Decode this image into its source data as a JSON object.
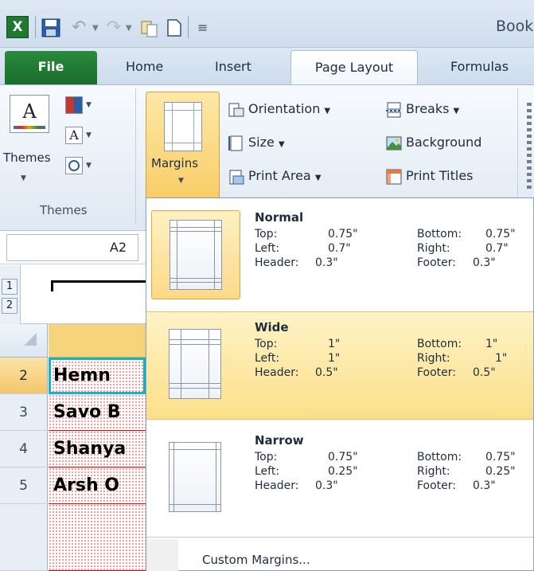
{
  "qat": {
    "app_icon": "excel-logo-icon",
    "logo_letter": "X",
    "title": "Book"
  },
  "tabs": [
    {
      "label": "File"
    },
    {
      "label": "Home"
    },
    {
      "label": "Insert"
    },
    {
      "label": "Page Layout",
      "active": true
    },
    {
      "label": "Formulas"
    }
  ],
  "ribbon": {
    "themes": {
      "label": "Themes",
      "group_title": "Themes",
      "font_glyph": "A"
    },
    "margins": {
      "label": "Margins"
    },
    "orientation": {
      "label": "Orientation"
    },
    "size": {
      "label": "Size"
    },
    "print_area": {
      "label": "Print Area"
    },
    "breaks": {
      "label": "Breaks"
    },
    "background": {
      "label": "Background"
    },
    "print_titles": {
      "label": "Print Titles"
    }
  },
  "namebox": {
    "value": "A2"
  },
  "outline": {
    "levels": [
      "1",
      "2"
    ]
  },
  "rows": [
    {
      "num": "2",
      "text": "Hemn ",
      "selected": true
    },
    {
      "num": "3",
      "text": "Savo B"
    },
    {
      "num": "4",
      "text": "Shanya"
    },
    {
      "num": "5",
      "text": "Arsh O"
    }
  ],
  "margins_menu": {
    "options": [
      {
        "name": "Normal",
        "top_label": "Top:",
        "top": "0.75\"",
        "bottom_label": "Bottom:",
        "bottom": "0.75\"",
        "left_label": "Left:",
        "left": "0.7\"",
        "right_label": "Right:",
        "right": "0.7\"",
        "header_label": "Header:",
        "header": "0.3\"",
        "footer_label": "Footer:",
        "footer": "0.3\"",
        "selected": true
      },
      {
        "name": "Wide",
        "top_label": "Top:",
        "top": "1\"",
        "bottom_label": "Bottom:",
        "bottom": "1\"",
        "left_label": "Left:",
        "left": "1\"",
        "right_label": "Right:",
        "right": "1\"",
        "header_label": "Header:",
        "header": "0.5\"",
        "footer_label": "Footer:",
        "footer": "0.5\"",
        "hovered": true
      },
      {
        "name": "Narrow",
        "top_label": "Top:",
        "top": "0.75\"",
        "bottom_label": "Bottom:",
        "bottom": "0.75\"",
        "left_label": "Left:",
        "left": "0.25\"",
        "right_label": "Right:",
        "right": "0.25\"",
        "header_label": "Header:",
        "header": "0.3\"",
        "footer_label": "Footer:",
        "footer": "0.3\""
      }
    ],
    "custom_label": "Custom Margins..."
  },
  "colors": {
    "file_tab": "#1a6d2b",
    "hover": "#fbdf8a",
    "cell_border": "#ee0000",
    "active_cell": "#11b4c8"
  }
}
